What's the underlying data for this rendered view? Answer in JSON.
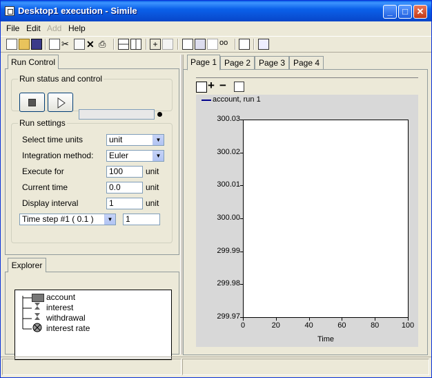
{
  "window": {
    "title": "Desktop1  execution - Simile"
  },
  "menu": {
    "file": "File",
    "edit": "Edit",
    "add": "Add",
    "help": "Help"
  },
  "left_panel": {
    "tab": "Run Control",
    "run_status": {
      "legend": "Run status and control",
      "progress": 0
    },
    "run_settings": {
      "legend": "Run settings",
      "time_units_label": "Select time units",
      "time_units_value": "unit",
      "integration_label": "Integration method:",
      "integration_value": "Euler",
      "execute_for_label": "Execute for",
      "execute_for_value": "100",
      "execute_for_unit": "unit",
      "current_time_label": "Current time",
      "current_time_value": "0.0",
      "current_time_unit": "unit",
      "display_interval_label": "Display interval",
      "display_interval_value": "1",
      "display_interval_unit": "unit",
      "timestep_select": "Time step #1 ( 0.1 )",
      "timestep_value": "1"
    }
  },
  "explorer": {
    "tab": "Explorer",
    "items": [
      {
        "label": "account",
        "icon": "compartment-icon"
      },
      {
        "label": "interest",
        "icon": "flow-icon"
      },
      {
        "label": "withdrawal",
        "icon": "flow-icon"
      },
      {
        "label": "interest rate",
        "icon": "variable-icon"
      }
    ]
  },
  "pages": {
    "tabs": [
      "Page 1",
      "Page 2",
      "Page 3",
      "Page 4"
    ],
    "active": 0
  },
  "chart_data": {
    "type": "line",
    "title": "",
    "xlabel": "Time",
    "ylabel": "",
    "xlim": [
      0,
      100
    ],
    "ylim": [
      299.97,
      300.03
    ],
    "x_ticks": [
      "0",
      "20",
      "40",
      "60",
      "80",
      "100"
    ],
    "y_ticks": [
      "300.03",
      "300.02",
      "300.01",
      "300.00",
      "299.99",
      "299.98",
      "299.97"
    ],
    "series": [
      {
        "name": "account, run 1",
        "color": "#00008b",
        "values": []
      }
    ],
    "legend_position": "top-left"
  }
}
